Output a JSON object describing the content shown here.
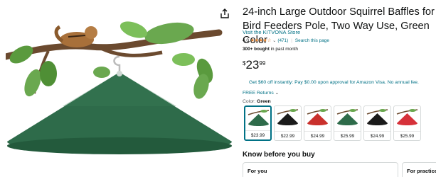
{
  "product": {
    "title": "24-inch Large Outdoor Squirrel Baffles for Bird Feeders Pole, Two Way Use, Green Color",
    "store_link": "Visit the KITVONA Store",
    "rating_value": "4.0",
    "rating_stars": "★★★★☆",
    "rating_count": "(471)",
    "search_page": "Search this page",
    "bought_bold": "300+ bought",
    "bought_rest": " in past month",
    "price_currency": "$",
    "price_whole": "23",
    "price_fraction": "99",
    "promo": "Get $60 off instantly: Pay $0.00 upon approval for Amazon Visa. No annual fee.",
    "free_returns": "FREE Returns",
    "color_label": "Color: ",
    "color_value": "Green"
  },
  "swatches": [
    {
      "price": "$23.99",
      "color": "#2e6b4a",
      "selected": true
    },
    {
      "price": "$22.99",
      "color": "#1a1a1a",
      "selected": false
    },
    {
      "price": "$24.99",
      "color": "#c9302c",
      "selected": false
    },
    {
      "price": "$25.99",
      "color": "#2e6b4a",
      "selected": false
    },
    {
      "price": "$24.99",
      "color": "#1a1a1a",
      "selected": false
    },
    {
      "price": "$25.99",
      "color": "#d6313a",
      "selected": false
    }
  ],
  "know_before": {
    "heading": "Know before you buy",
    "cards": [
      "For you",
      "For practice"
    ]
  },
  "icons": {
    "share": "share-icon",
    "rating_dropdown": "chevron-down-icon",
    "returns_dropdown": "chevron-down-icon"
  },
  "colors": {
    "link": "#007185",
    "star": "#de7921",
    "baffle_green": "#2e6b4a"
  }
}
